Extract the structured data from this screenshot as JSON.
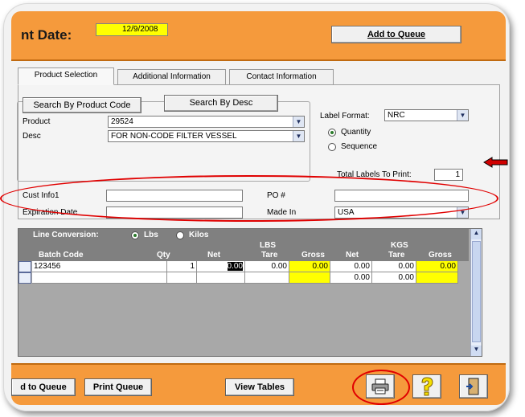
{
  "header": {
    "title": "nt Date:",
    "date_value": "12/9/2008",
    "add_to_queue": "Add to Queue"
  },
  "tabs": [
    {
      "label": "Product Selection"
    },
    {
      "label": "Additional Information"
    },
    {
      "label": "Contact Information"
    }
  ],
  "product": {
    "search_code": "Search By Product Code",
    "search_desc": "Search By Desc",
    "product_label": "Product",
    "product_value": "29524",
    "desc_label": "Desc",
    "desc_value": "FOR NON-CODE FILTER VESSEL"
  },
  "label_format": {
    "label": "Label Format:",
    "value": "NRC",
    "quantity": "Quantity",
    "sequence": "Sequence",
    "selected": "Quantity",
    "total_label": "Total Labels To Print:",
    "total_value": "1"
  },
  "info": {
    "cust_info_label": "Cust Info1",
    "cust_info_value": "",
    "po_label": "PO #",
    "po_value": "",
    "expiration_label": "Expiration Date",
    "expiration_value": "",
    "made_in_label": "Made In",
    "made_in_value": "USA"
  },
  "grid": {
    "line_conversion": "Line Conversion:",
    "lbs_option": "Lbs",
    "kilos_option": "Kilos",
    "lbs_group": "LBS",
    "kgs_group": "KGS",
    "columns": [
      "Batch Code",
      "Qty",
      "Net",
      "Tare",
      "Gross",
      "Net",
      "Tare",
      "Gross"
    ],
    "rows": [
      {
        "batch": "123456",
        "qty": "1",
        "lbs_net": "0.00",
        "lbs_tare": "0.00",
        "lbs_gross": "0.00",
        "kgs_net": "0.00",
        "kgs_tare": "0.00",
        "kgs_gross": "0.00"
      },
      {
        "batch": "",
        "qty": "",
        "lbs_net": "",
        "lbs_tare": "",
        "lbs_gross": "",
        "kgs_net": "0.00",
        "kgs_tare": "0.00",
        "kgs_gross": ""
      }
    ]
  },
  "footer": {
    "add_to_queue": "d to Queue",
    "print_queue": "Print Queue",
    "view_tables": "View Tables"
  },
  "icons": {
    "printer": "printer-icon",
    "help": "help-icon",
    "exit": "exit-door-icon"
  },
  "colors": {
    "accent_orange": "#f59a3c",
    "highlight_yellow": "#ffff00",
    "annotation_red": "#e00000"
  }
}
